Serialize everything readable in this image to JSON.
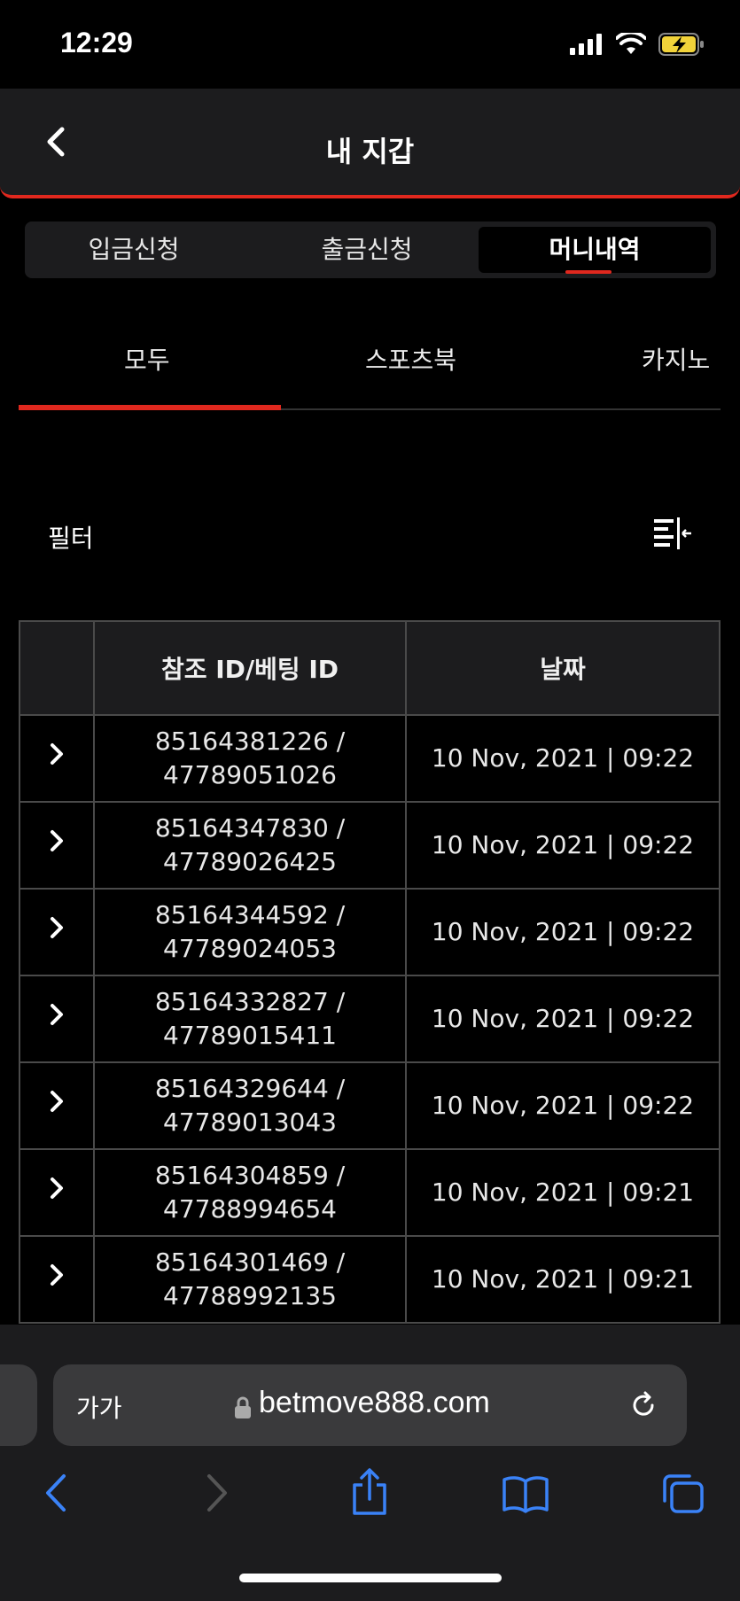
{
  "status": {
    "time": "12:29"
  },
  "header": {
    "title": "내 지갑"
  },
  "segments": [
    {
      "label": "입금신청",
      "active": false
    },
    {
      "label": "출금신청",
      "active": false
    },
    {
      "label": "머니내역",
      "active": true
    }
  ],
  "subtabs": [
    {
      "label": "모두",
      "active": true
    },
    {
      "label": "스포츠북",
      "active": false
    },
    {
      "label": "카지노",
      "active": false
    }
  ],
  "filter": {
    "label": "필터"
  },
  "table": {
    "headers": [
      "",
      "참조 ID/베팅 ID",
      "날짜"
    ],
    "rows": [
      {
        "ref": "85164381226 /",
        "bet": "47789051026",
        "date": "10 Nov, 2021 | 09:22"
      },
      {
        "ref": "85164347830 /",
        "bet": "47789026425",
        "date": "10 Nov, 2021 | 09:22"
      },
      {
        "ref": "85164344592 /",
        "bet": "47789024053",
        "date": "10 Nov, 2021 | 09:22"
      },
      {
        "ref": "85164332827 /",
        "bet": "47789015411",
        "date": "10 Nov, 2021 | 09:22"
      },
      {
        "ref": "85164329644 /",
        "bet": "47789013043",
        "date": "10 Nov, 2021 | 09:22"
      },
      {
        "ref": "85164304859 /",
        "bet": "47788994654",
        "date": "10 Nov, 2021 | 09:21"
      },
      {
        "ref": "85164301469 /",
        "bet": "47788992135",
        "date": "10 Nov, 2021 | 09:21"
      }
    ]
  },
  "browser": {
    "text_size_label": "가가",
    "url": "betmove888.com"
  },
  "colors": {
    "accent": "#e0281e",
    "ios_blue": "#3a82f7"
  }
}
